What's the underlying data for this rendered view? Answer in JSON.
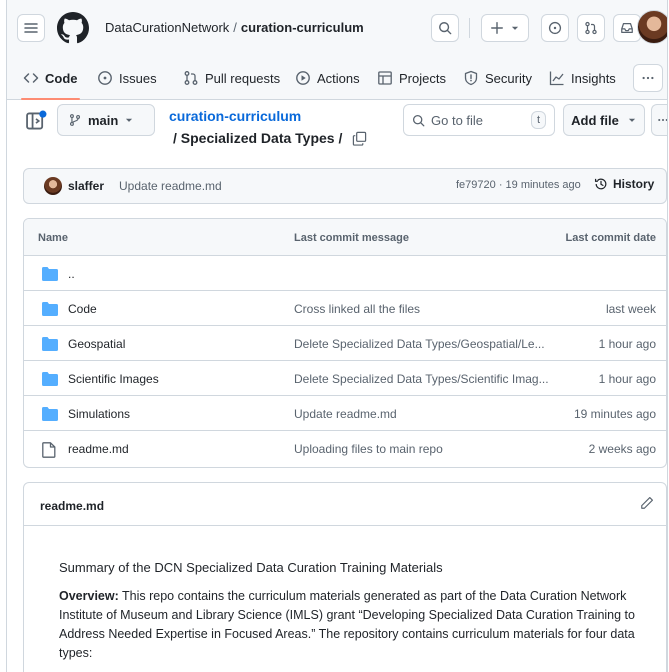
{
  "header": {
    "owner": "DataCurationNetwork",
    "separator": "/",
    "repo": "curation-curriculum"
  },
  "tabs": [
    {
      "label": "Code",
      "icon": "code-icon",
      "active": true
    },
    {
      "label": "Issues",
      "icon": "issue-icon"
    },
    {
      "label": "Pull requests",
      "icon": "pull-request-icon"
    },
    {
      "label": "Actions",
      "icon": "play-icon"
    },
    {
      "label": "Projects",
      "icon": "table-icon"
    },
    {
      "label": "Security",
      "icon": "shield-icon"
    },
    {
      "label": "Insights",
      "icon": "graph-icon"
    }
  ],
  "nav": {
    "branch": "main",
    "breadcrumb_repo": "curation-curriculum",
    "breadcrumb_folder": "/ Specialized Data Types /",
    "goto_placeholder": "Go to file",
    "goto_shortcut": "t",
    "add_file": "Add file"
  },
  "commit": {
    "author": "slaffer",
    "message": "Update readme.md",
    "meta": "fe79720 · 19 minutes ago",
    "history_label": "History"
  },
  "table": {
    "headers": {
      "name": "Name",
      "message": "Last commit message",
      "date": "Last commit date"
    },
    "rows": [
      {
        "name": "..",
        "type": "folder",
        "message": "",
        "date": ""
      },
      {
        "name": "Code",
        "type": "folder",
        "message": "Cross linked all the files",
        "date": "last week"
      },
      {
        "name": "Geospatial",
        "type": "folder",
        "message": "Delete Specialized Data Types/Geospatial/Le...",
        "date": "1 hour ago"
      },
      {
        "name": "Scientific Images",
        "type": "folder",
        "message": "Delete Specialized Data Types/Scientific Imag...",
        "date": "1 hour ago"
      },
      {
        "name": "Simulations",
        "type": "folder",
        "message": "Update readme.md",
        "date": "19 minutes ago"
      },
      {
        "name": "readme.md",
        "type": "file",
        "message": "Uploading files to main repo",
        "date": "2 weeks ago"
      }
    ]
  },
  "readme": {
    "title": "readme.md",
    "heading": "Summary of the DCN Specialized Data Curation Training Materials",
    "overview_label": "Overview:",
    "overview_text": " This repo contains the curriculum materials generated as part of the Data Curation Network Institute of Museum and Library Science (IMLS) grant “Developing Specialized Data Curation Training to Address Needed Expertise in Focused Areas.” The repository contains curriculum materials for four data types:"
  },
  "colors": {
    "accent": "#0969da",
    "folder": "#54aeff",
    "tab_underline": "#fd8c73",
    "border": "#d0d7de",
    "muted": "#59636e"
  }
}
